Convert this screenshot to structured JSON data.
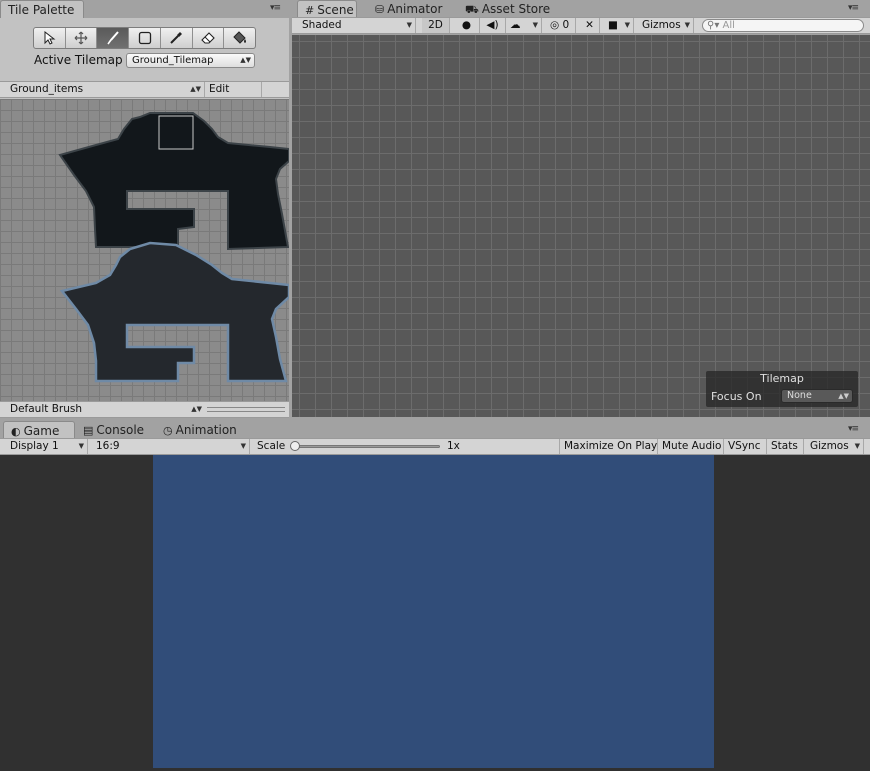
{
  "palette": {
    "tab_label": "Tile Palette",
    "tools": [
      {
        "name": "select-tool",
        "icon": "arrow-icon"
      },
      {
        "name": "move-tool",
        "icon": "move-icon"
      },
      {
        "name": "paint-tool",
        "icon": "brush-icon"
      },
      {
        "name": "box-fill-tool",
        "icon": "rectangle-icon"
      },
      {
        "name": "picker-tool",
        "icon": "eyedropper-icon"
      },
      {
        "name": "erase-tool",
        "icon": "eraser-icon"
      },
      {
        "name": "fill-tool",
        "icon": "paint-bucket-icon"
      }
    ],
    "active_tool_index": 2,
    "active_tilemap_label": "Active Tilemap",
    "active_tilemap_value": "Ground_Tilemap",
    "palette_select": "Ground_items",
    "edit_label": "Edit",
    "brush_select": "Default Brush"
  },
  "scene": {
    "tabs": [
      {
        "label": "Scene",
        "icon": "#"
      },
      {
        "label": "Animator",
        "icon": "⛁"
      },
      {
        "label": "Asset Store",
        "icon": "⛟"
      }
    ],
    "shading_mode": "Shaded",
    "mode_2d": "2D",
    "hidden_count": "0",
    "gizmos_label": "Gizmos",
    "search_placeholder": "All",
    "overlay": {
      "title": "Tilemap",
      "focus_label": "Focus On",
      "focus_value": "None"
    }
  },
  "game": {
    "tabs": [
      {
        "label": "Game",
        "icon": "◐"
      },
      {
        "label": "Console",
        "icon": "▤"
      },
      {
        "label": "Animation",
        "icon": "◷"
      }
    ],
    "display": "Display 1",
    "aspect": "16:9",
    "scale_label": "Scale",
    "scale_value": "1x",
    "maximize_on_play": "Maximize On Play",
    "mute_audio": "Mute Audio",
    "vsync": "VSync",
    "stats": "Stats",
    "gizmos": "Gizmos",
    "camera_background": "#314d79"
  }
}
